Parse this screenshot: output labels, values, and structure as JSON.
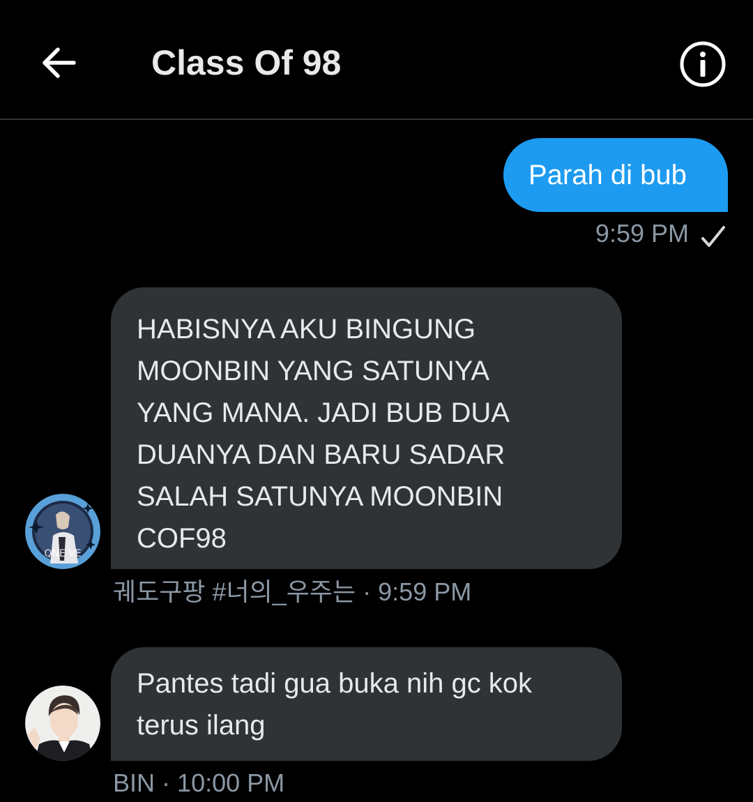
{
  "header": {
    "title": "Class Of 98",
    "back_icon": "arrow-left-icon",
    "info_icon": "info-circle-icon"
  },
  "messages": [
    {
      "direction": "outgoing",
      "text": "Parah di bub",
      "time": "9:59 PM",
      "status_icon": "check-icon",
      "bubble_color": "#1d9bf0"
    },
    {
      "direction": "incoming",
      "text": "HABISNYA AKU BINGUNG\nMOONBIN YANG SATUNYA\nYANG MANA. JADI BUB DUA\nDUANYA DAN BARU SADAR\nSALAH SATUNYA MOONBIN\nCOF98",
      "sender": "궤도구팡 #너의_우주는",
      "separator": "·",
      "time": "9:59 PM",
      "avatar_icon": "avatar-image",
      "bubble_color": "#2f3336"
    },
    {
      "direction": "incoming",
      "text": "Pantes tadi gua buka nih gc kok\nterus ilang",
      "sender": "BIN",
      "separator": "·",
      "time": "10:00 PM",
      "avatar_icon": "avatar-image",
      "bubble_color": "#2f3336"
    }
  ],
  "colors": {
    "background": "#000000",
    "accent": "#1d9bf0",
    "incoming_bubble": "#2f3336",
    "meta_text": "#8b98a5"
  }
}
